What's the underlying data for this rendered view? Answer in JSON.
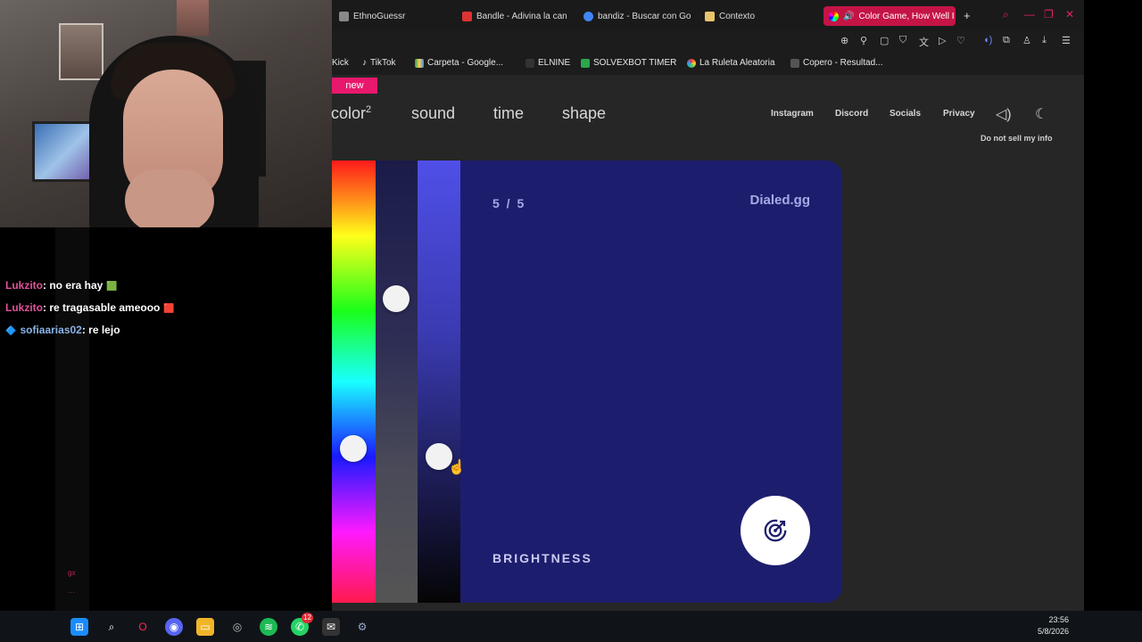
{
  "stream": {
    "chat": [
      {
        "user": "Lukzito",
        "text": ": no era hay",
        "emote": "🟩"
      },
      {
        "user": "Lukzito",
        "text": ": re tragasable ameooo",
        "emote": "🟥"
      },
      {
        "user": "sofiaarias02",
        "text": ": re lejo",
        "emote": ""
      }
    ],
    "mini_label": "gx"
  },
  "browser": {
    "tabs": [
      {
        "label": "EthnoGuessr"
      },
      {
        "label": "Bandle - Adivina la can"
      },
      {
        "label": "bandiz - Buscar con Go"
      },
      {
        "label": "Contexto"
      },
      {
        "label": "Color Game, How Well I"
      }
    ],
    "new_tab": "+",
    "bookmarks": [
      {
        "label": "Kick"
      },
      {
        "label": "TikTok"
      },
      {
        "label": "Carpeta - Google..."
      },
      {
        "label": "ELNINE"
      },
      {
        "label": "SOLVEXBOT TIMER"
      },
      {
        "label": "La Ruleta Aleatoria"
      },
      {
        "label": "Copero - Resultad..."
      }
    ]
  },
  "site": {
    "new_badge": "new",
    "nav": {
      "color": "color",
      "color_sup": "2",
      "sound": "sound",
      "time": "time",
      "shape": "shape",
      "instagram": "Instagram",
      "discord": "Discord",
      "socials": "Socials",
      "privacy": "Privacy",
      "dnsmpi": "Do not sell my info"
    },
    "game": {
      "counter": "5 / 5",
      "brand": "Dialed.gg",
      "label": "BRIGHTNESS",
      "slider_levels": {
        "hue": 0.66,
        "saturation": 0.3,
        "brightness": 0.68
      }
    },
    "colors": {
      "card": "#1d1d6e",
      "badge": "#e8186c"
    }
  },
  "taskbar": {
    "time": "23:56",
    "date": "5/8/2026",
    "badge": "12"
  }
}
